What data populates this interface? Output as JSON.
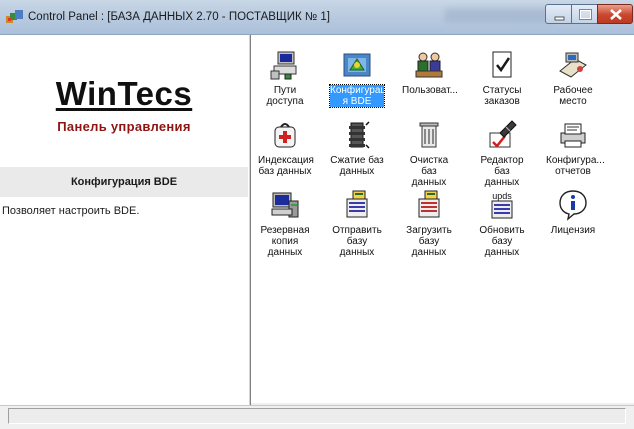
{
  "window": {
    "title": "Control Panel : [БАЗА ДАННЫХ 2.70 - ПОСТАВЩИК № 1]"
  },
  "logo": {
    "text_part1": "Win",
    "text_part2": "Tecs",
    "subtitle": "Панель управления"
  },
  "info": {
    "header": "Конфигурация BDE",
    "description": "Позволяет настроить BDE."
  },
  "items": [
    {
      "label": "Пути доступа",
      "icon": "access-paths-icon",
      "selected": false
    },
    {
      "label": "Конфигураци\nя BDE",
      "icon": "bde-config-icon",
      "selected": true
    },
    {
      "label": "Пользоват...",
      "icon": "users-icon",
      "selected": false
    },
    {
      "label": "Статусы\nзаказов",
      "icon": "order-status-icon",
      "selected": false
    },
    {
      "label": "Рабочее\nместо",
      "icon": "workplace-icon",
      "selected": false
    },
    {
      "label": "Индексация\nбаз данных",
      "icon": "db-indexing-icon",
      "selected": false
    },
    {
      "label": "Сжатие баз\nданных",
      "icon": "db-compress-icon",
      "selected": false
    },
    {
      "label": "Очистка баз\nданных",
      "icon": "db-cleanup-icon",
      "selected": false
    },
    {
      "label": "Редактор баз\nданных",
      "icon": "db-editor-icon",
      "selected": false
    },
    {
      "label": "Конфигура...\nотчетов",
      "icon": "reports-config-icon",
      "selected": false
    },
    {
      "label": "Резервная\nкопия данных",
      "icon": "backup-icon",
      "selected": false
    },
    {
      "label": "Отправить\nбазу данных",
      "icon": "send-db-icon",
      "selected": false
    },
    {
      "label": "Загрузить\nбазу данных",
      "icon": "load-db-icon",
      "selected": false
    },
    {
      "label": "Обновить\nбазу данных",
      "icon": "update-db-icon",
      "selected": false
    },
    {
      "label": "Лицензия",
      "icon": "license-icon",
      "selected": false
    }
  ],
  "update_icon_caption": "upds",
  "colors": {
    "selection": "#3399ff",
    "logo_subtitle": "#8e1414"
  }
}
